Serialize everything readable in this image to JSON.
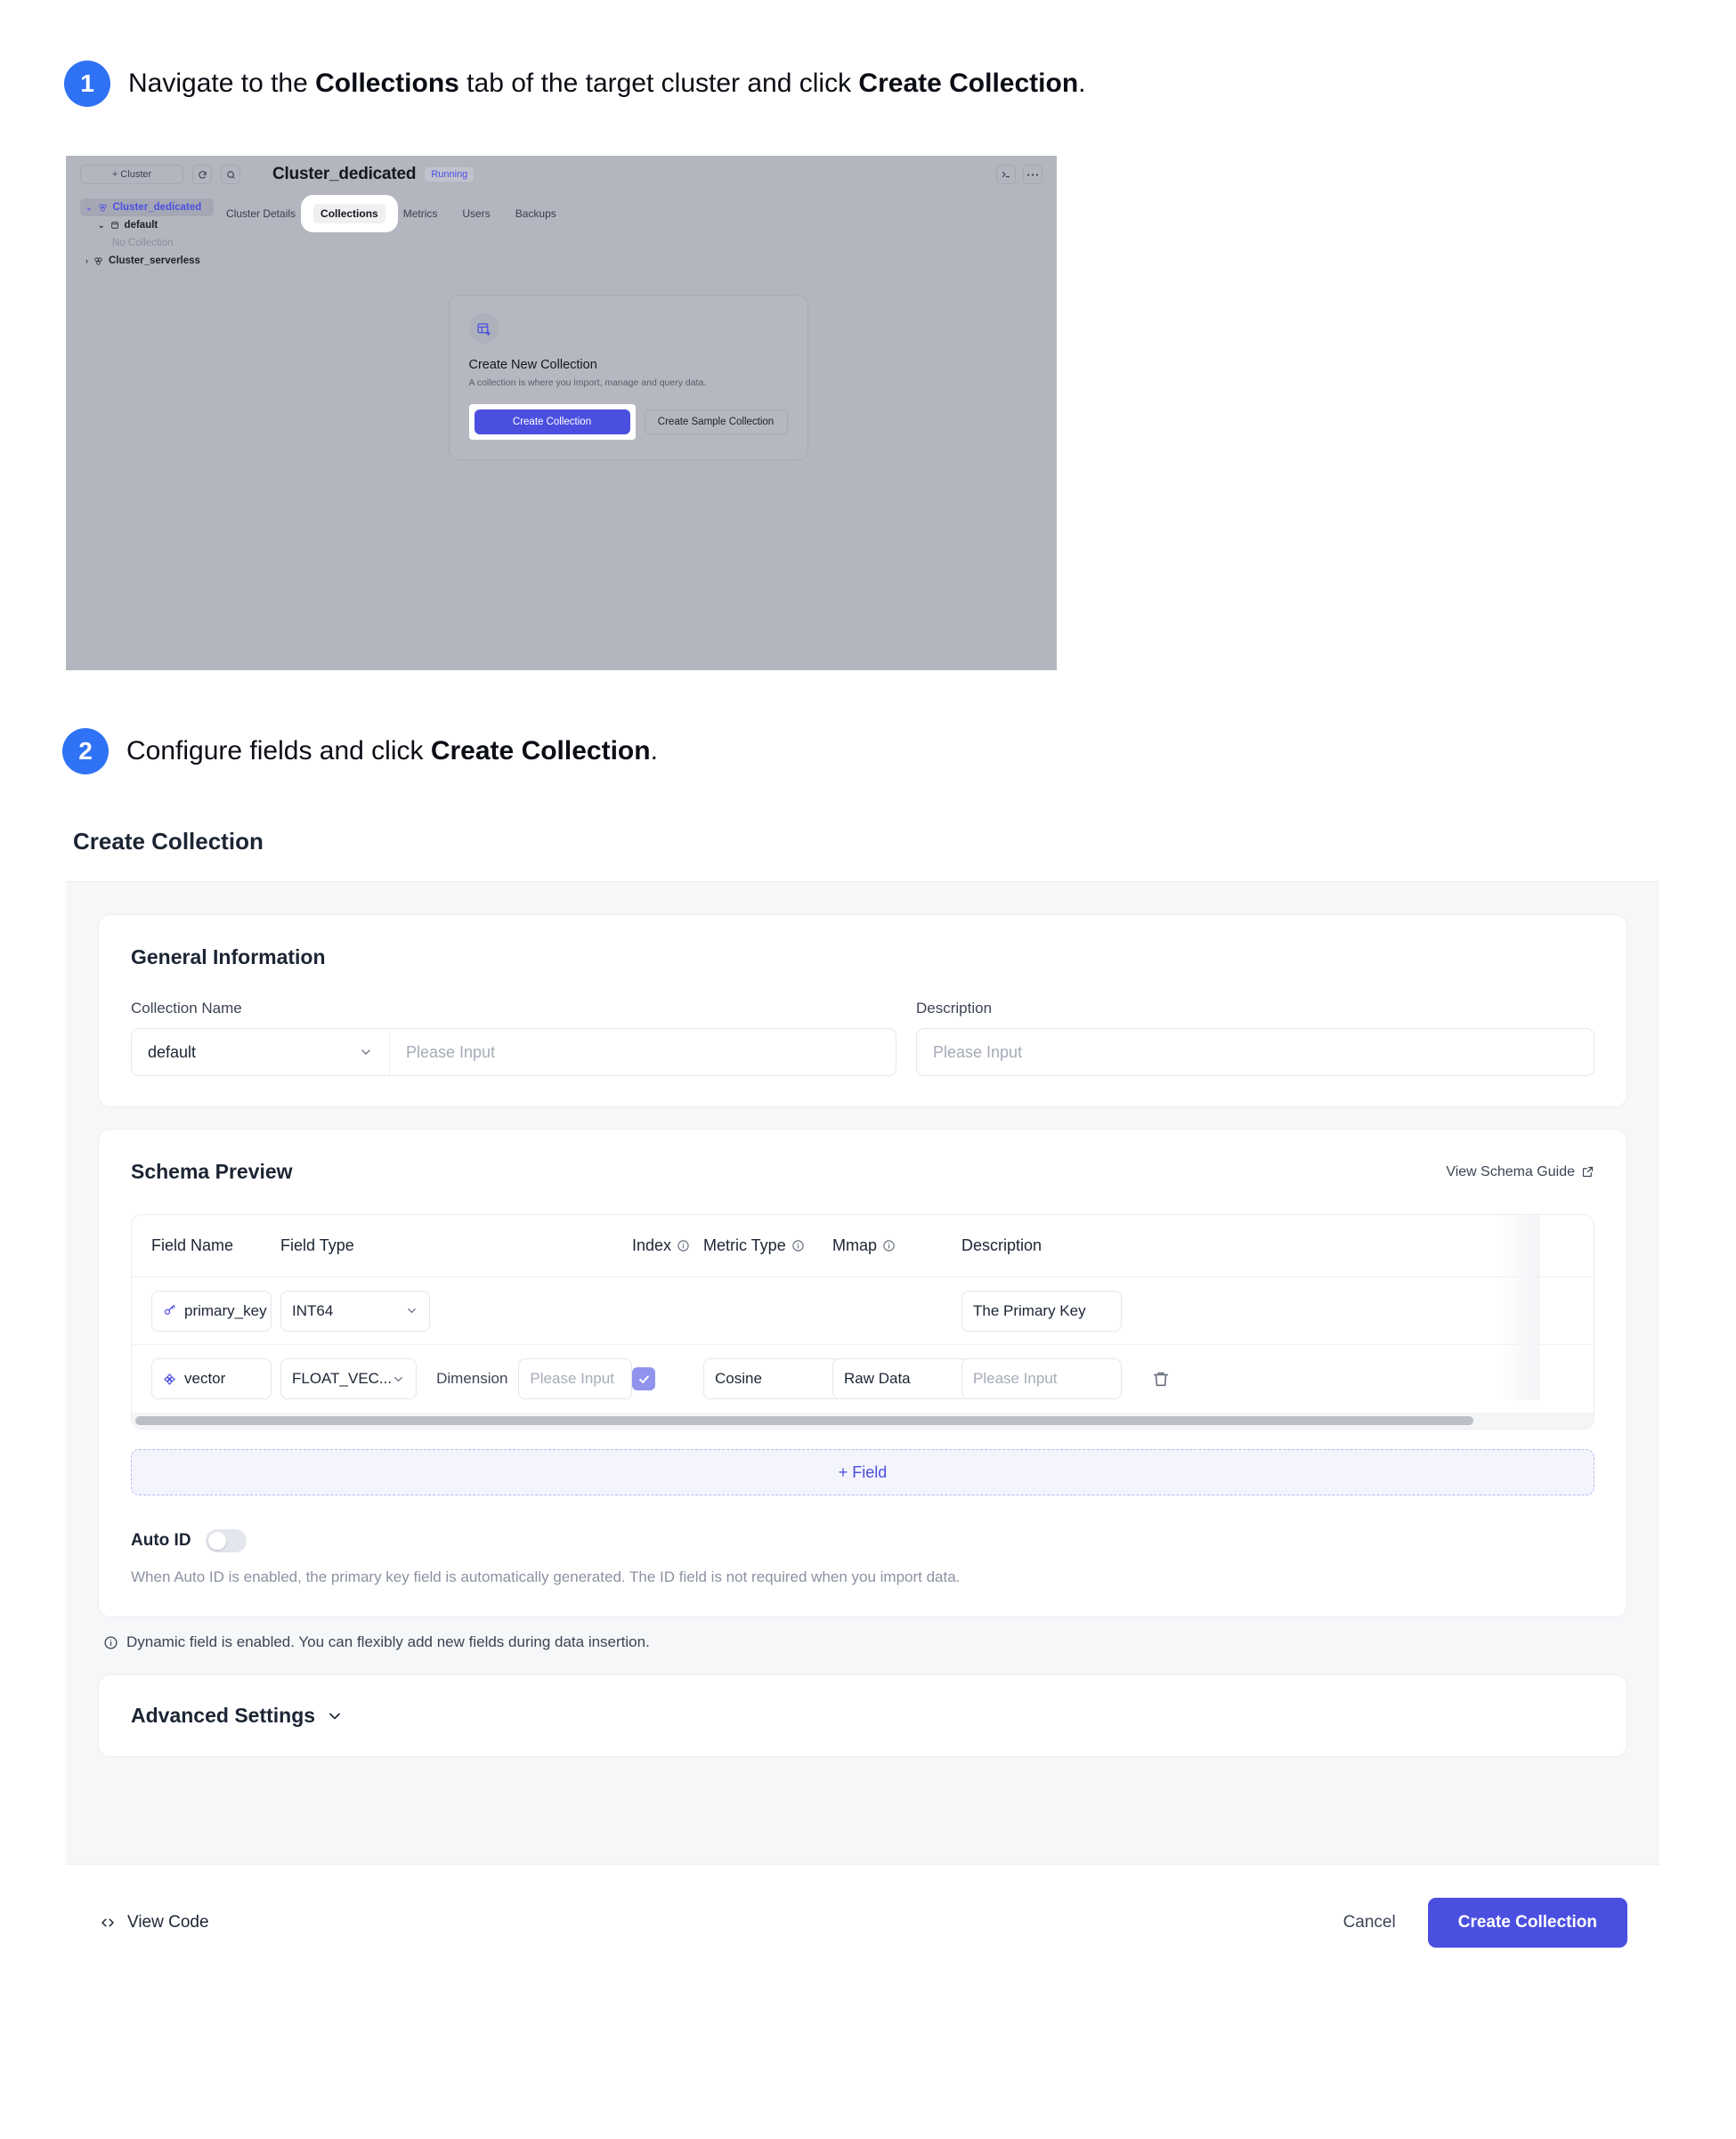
{
  "steps": [
    {
      "number": "1",
      "text_parts": [
        "Navigate to the ",
        "Collections",
        " tab of the target cluster and click ",
        "Create Collection",
        "."
      ]
    },
    {
      "number": "2",
      "text_parts": [
        "Configure fields and click ",
        "Create Collection",
        "."
      ]
    }
  ],
  "step1": {
    "number": "1",
    "prefix": "Navigate to the ",
    "bold1": "Collections",
    "middle": " tab of the target cluster and click ",
    "bold2": "Create Collection",
    "suffix": "."
  },
  "step2": {
    "number": "2",
    "prefix": "Configure fields and click ",
    "bold1": "Create Collection",
    "suffix": "."
  },
  "console": {
    "add_cluster_label": "+ Cluster",
    "refresh_icon": "refresh-icon",
    "search_icon": "search-icon",
    "terminal_icon": "terminal-icon",
    "more_icon": "more-icon",
    "cluster_title": "Cluster_dedicated",
    "status_badge": "Running",
    "tree": [
      {
        "label": "Cluster_dedicated",
        "level": 1,
        "active": true,
        "caret": "⌄"
      },
      {
        "label": "default",
        "level": 2,
        "active": false,
        "caret": "⌄"
      },
      {
        "label": "No Collection",
        "level": 3,
        "active": false,
        "caret": ""
      },
      {
        "label": "Cluster_serverless",
        "level": 1,
        "active": false,
        "caret": "›"
      }
    ],
    "tabs": [
      {
        "label": "Cluster Details",
        "highlight": false
      },
      {
        "label": "Collections",
        "highlight": true
      },
      {
        "label": "Metrics",
        "highlight": false
      },
      {
        "label": "Users",
        "highlight": false
      },
      {
        "label": "Backups",
        "highlight": false
      }
    ],
    "card": {
      "icon": "table-add-icon",
      "title": "Create New Collection",
      "subtitle": "A collection is where you import, manage and query data.",
      "primary_button": "Create Collection",
      "secondary_button": "Create Sample Collection"
    }
  },
  "dialog": {
    "title": "Create Collection",
    "general": {
      "section_title": "General Information",
      "collection_name_label": "Collection Name",
      "db_selected": "default",
      "name_placeholder": "Please Input",
      "description_label": "Description",
      "description_placeholder": "Please Input"
    },
    "schema": {
      "section_title": "Schema Preview",
      "guide_link": "View Schema Guide",
      "guide_icon": "external-link-icon",
      "columns": [
        {
          "label": "Field Name",
          "info": false
        },
        {
          "label": "Field Type",
          "info": false
        },
        {
          "label": "Index",
          "info": true
        },
        {
          "label": "Metric Type",
          "info": true
        },
        {
          "label": "Mmap",
          "info": true
        },
        {
          "label": "Description",
          "info": false
        }
      ],
      "rows": [
        {
          "icon": "key-icon",
          "field_name": "primary_key",
          "field_type": "INT64",
          "dimension_label": "",
          "dimension_placeholder": "",
          "index_checked": false,
          "metric_type": "",
          "mmap": "",
          "description": "The Primary Key",
          "description_is_placeholder": false,
          "deletable": false
        },
        {
          "icon": "vector-icon",
          "field_name": "vector",
          "field_type": "FLOAT_VEC...",
          "dimension_label": "Dimension",
          "dimension_placeholder": "Please Input",
          "index_checked": true,
          "metric_type": "Cosine",
          "mmap": "Raw Data",
          "description": "Please Input",
          "description_is_placeholder": true,
          "deletable": true,
          "delete_icon": "trash-icon"
        }
      ],
      "add_field_label": "+ Field",
      "auto_id_label": "Auto ID",
      "auto_id_enabled": false,
      "auto_id_help": "When Auto ID is enabled, the primary key field is automatically generated. The ID field is not required when you import data.",
      "dynamic_note_icon": "info-icon",
      "dynamic_note": "Dynamic field is enabled. You can flexibly add new fields during data insertion."
    },
    "advanced": {
      "title": "Advanced Settings",
      "chevron": "chevron-down-icon"
    },
    "footer": {
      "view_code_icon": "code-icon",
      "view_code_label": "View Code",
      "cancel_label": "Cancel",
      "create_label": "Create Collection"
    }
  },
  "colors": {
    "accent_blue": "#2f72f5",
    "brand_purple": "#4b4fe0",
    "checkbox_purple": "#8f93ee",
    "dialog_bg": "#f6f7f9",
    "card_bg": "#ffffff",
    "border": "#eceef2",
    "text_primary": "#1c2534",
    "text_muted": "#8b92a1",
    "placeholder": "#a5abb8"
  }
}
